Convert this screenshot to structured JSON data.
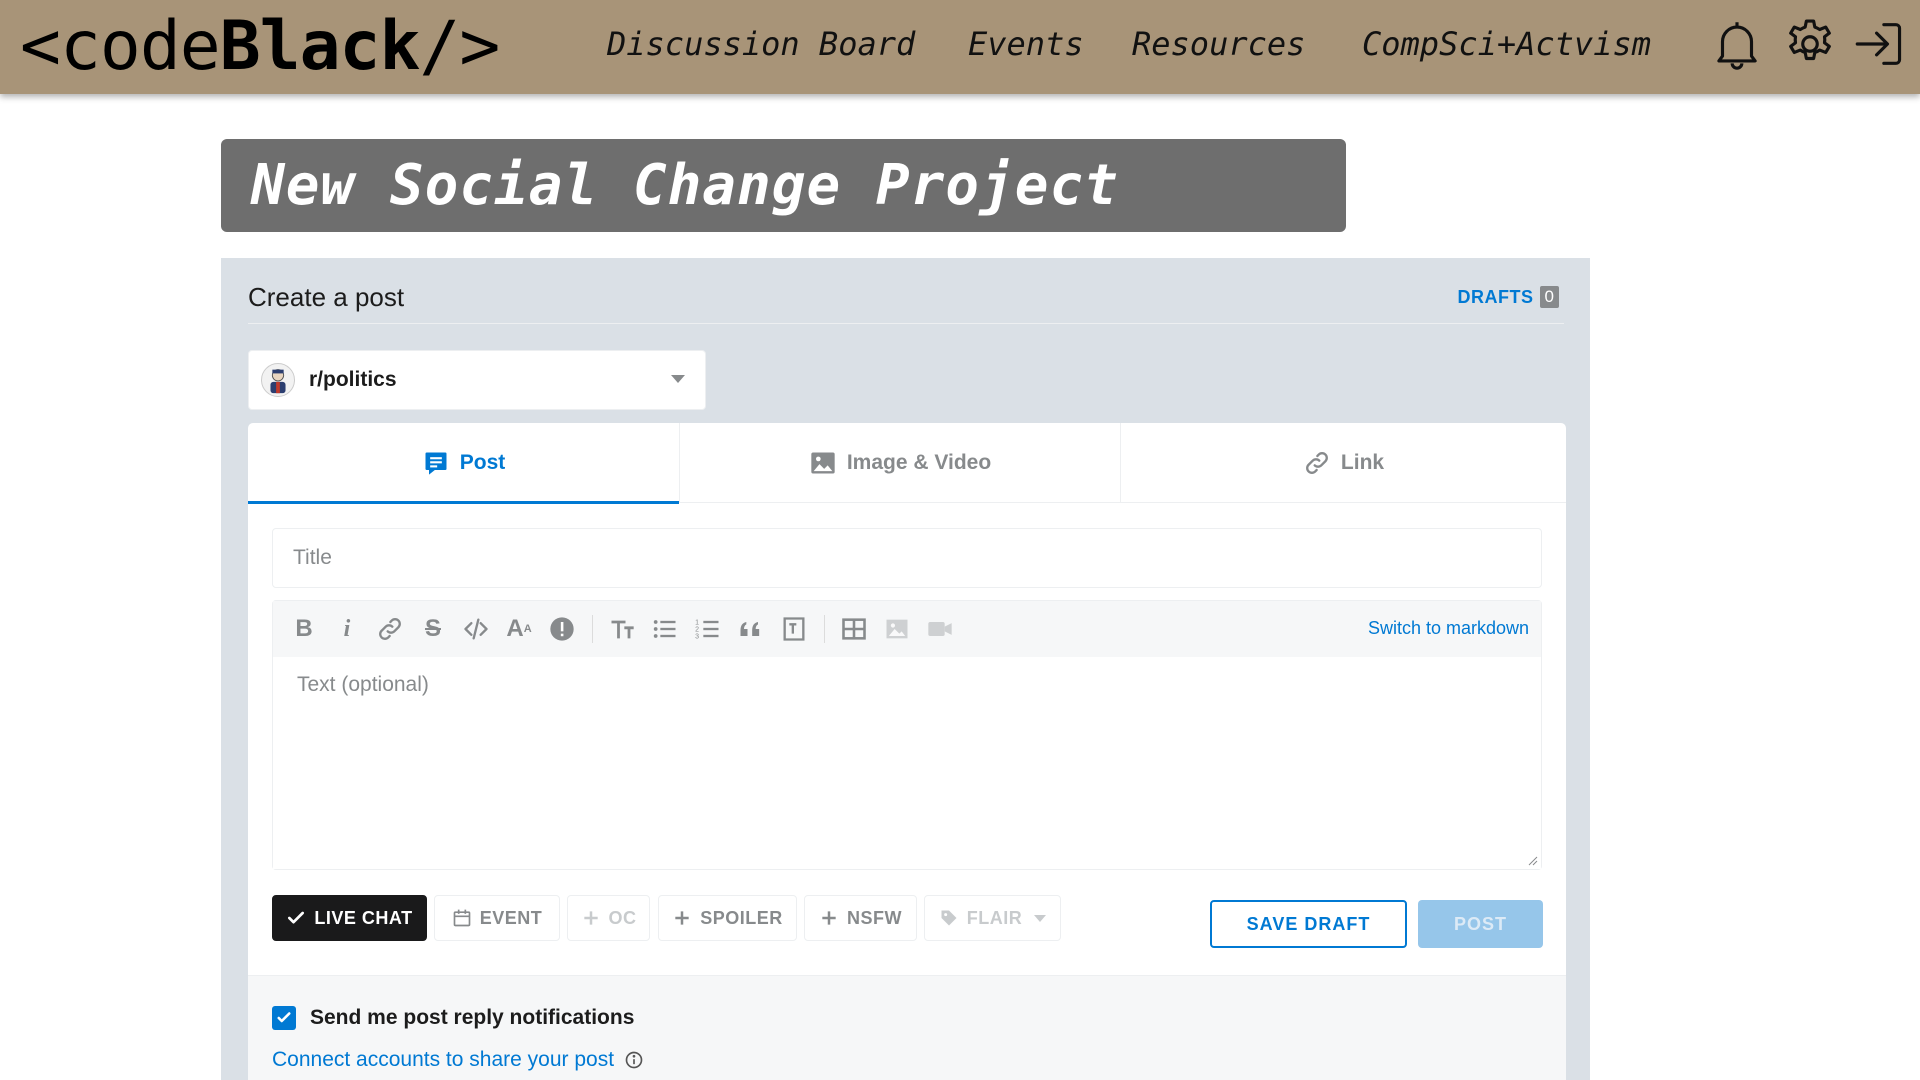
{
  "nav": {
    "logo_open": "<code",
    "logo_bold": "Black",
    "logo_close": "/>",
    "links": [
      "Discussion Board",
      "Events",
      "Resources",
      "CompSci+Actvism"
    ],
    "icons": [
      "bell-icon",
      "gear-icon",
      "logout-icon"
    ]
  },
  "banner": {
    "title": "New Social Change Project"
  },
  "create": {
    "title": "Create a post",
    "drafts_label": "DRAFTS",
    "drafts_count": "0",
    "community": "r/politics",
    "tabs": [
      {
        "label": "Post",
        "icon": "post-icon",
        "active": true
      },
      {
        "label": "Image & Video",
        "icon": "image-icon",
        "active": false
      },
      {
        "label": "Link",
        "icon": "link-icon",
        "active": false
      }
    ],
    "title_placeholder": "Title",
    "text_placeholder": "Text (optional)",
    "switch_markdown": "Switch to markdown",
    "chips": [
      {
        "label": "LIVE CHAT",
        "icon": "check-icon",
        "state": "active"
      },
      {
        "label": "EVENT",
        "icon": "calendar-icon",
        "state": "normal"
      },
      {
        "label": "OC",
        "icon": "plus-icon",
        "state": "disabled"
      },
      {
        "label": "SPOILER",
        "icon": "plus-icon",
        "state": "normal"
      },
      {
        "label": "NSFW",
        "icon": "plus-icon",
        "state": "normal"
      },
      {
        "label": "FLAIR",
        "icon": "tag-icon",
        "state": "disabled"
      }
    ],
    "save_draft": "SAVE DRAFT",
    "post": "POST",
    "notify_label": "Send me post reply notifications",
    "notify_checked": true,
    "connect_label": "Connect accounts to share your post"
  },
  "colors": {
    "nav_bg": "#a89478",
    "banner_bg": "#6e6e6e",
    "panel_bg": "#dae0e6",
    "accent": "#0079d3",
    "post_disabled": "#96c6ea"
  }
}
